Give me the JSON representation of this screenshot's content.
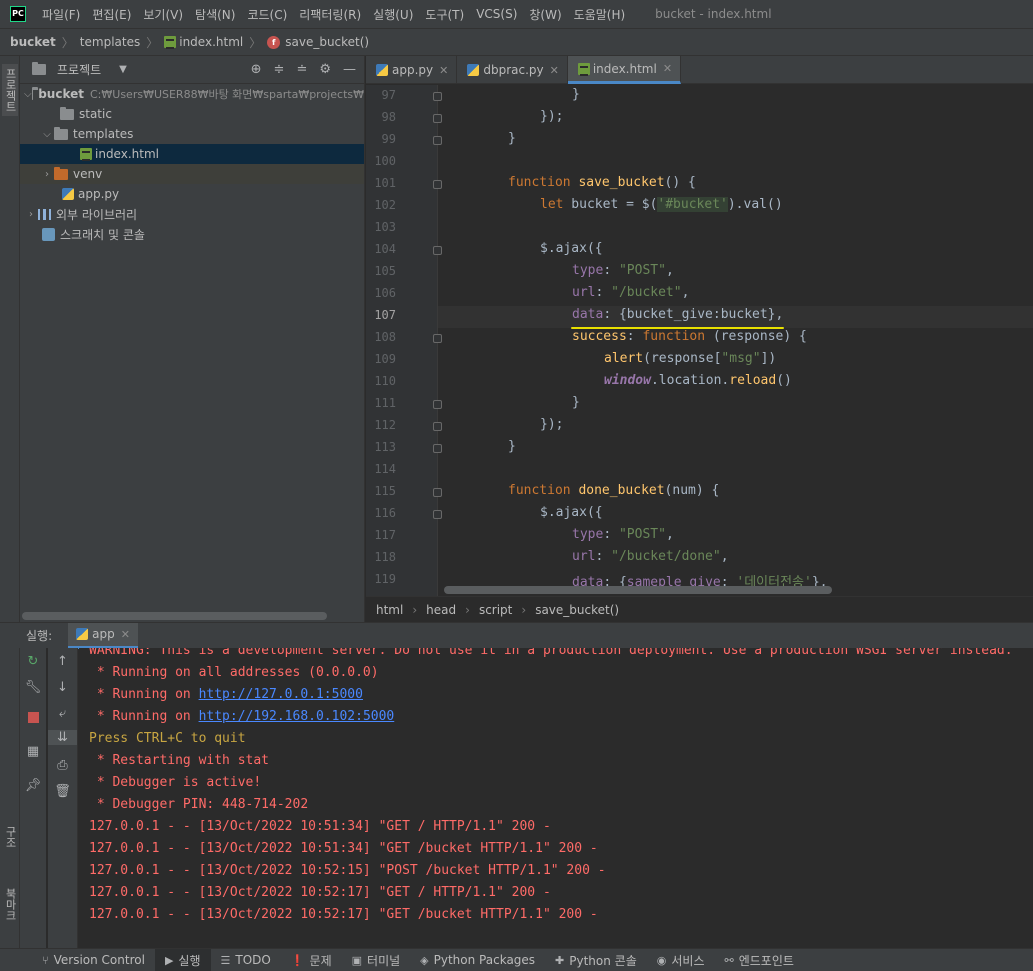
{
  "menu": {
    "items": [
      "파일(F)",
      "편집(E)",
      "보기(V)",
      "탐색(N)",
      "코드(C)",
      "리팩터링(R)",
      "실행(U)",
      "도구(T)",
      "VCS(S)",
      "창(W)",
      "도움말(H)"
    ],
    "window_title": "bucket - index.html",
    "logo": "PC"
  },
  "breadcrumb": {
    "project": "bucket",
    "folder": "templates",
    "file": "index.html",
    "func": "save_bucket()",
    "func_icon": "f"
  },
  "left_strip": {
    "project_tab": "프로젝트",
    "structure_tab": "구조",
    "bookmarks_tab": "북마크"
  },
  "project_panel": {
    "title": "프로젝트",
    "root": "bucket",
    "root_path": "C:₩Users₩USER88₩바탕 화면₩sparta₩projects₩",
    "items": {
      "static": "static",
      "templates": "templates",
      "index": "index.html",
      "venv": "venv",
      "app": "app.py",
      "libs": "외부 라이브러리",
      "scratch": "스크래치 및 콘솔"
    }
  },
  "editor_tabs": [
    {
      "label": "app.py"
    },
    {
      "label": "dbprac.py"
    },
    {
      "label": "index.html"
    }
  ],
  "line_numbers": [
    "97",
    "98",
    "99",
    "100",
    "101",
    "102",
    "103",
    "104",
    "105",
    "106",
    "107",
    "108",
    "109",
    "110",
    "111",
    "112",
    "113",
    "114",
    "115",
    "116",
    "117",
    "118",
    "119"
  ],
  "current_line": "107",
  "code": {
    "l97": "}",
    "l98": "});",
    "l99": "}",
    "kw_function": "function",
    "save_fn": "save_bucket",
    "done_fn": "done_bucket",
    "paren_open": "() {",
    "l102_let": "let",
    "l102_mid": " bucket = $(",
    "l102_str": "'#bucket'",
    "l102_end": ").val()",
    "ajax": "$.ajax({",
    "type_key": "type",
    "type_val": "\"POST\"",
    "url_key": "url",
    "url_val": "\"/bucket\"",
    "data_key": "data",
    "data_val": "{bucket_give:bucket}",
    "success_key": "success",
    "success_sig": "(response) {",
    "alert_fn": "alert",
    "alert_args_open": "(response[",
    "alert_str": "\"msg\"",
    "alert_args_close": "])",
    "window_obj": "window",
    "location": ".location.",
    "reload": "reload",
    "reload_paren": "()",
    "done_sig": "(num) {",
    "url_done_val": "\"/bucket/done\"",
    "data_done_open": "{",
    "data_done_key": "sameple_give",
    "data_done_str": "'데이터전송'",
    "data_done_close": "},"
  },
  "editor_breadcrumb": [
    "html",
    "head",
    "script",
    "save_bucket()"
  ],
  "run_panel": {
    "label": "실행:",
    "tab": "app",
    "lines": {
      "warning": "WARNING: This is a development server. Do not use it in a production deployment. Use a production WSGI server instead.",
      "running_all": " * Running on all addresses (0.0.0.0)",
      "running_prefix": " * Running on ",
      "url1": "http://127.0.0.1:5000",
      "url2": "http://192.168.0.102:5000",
      "press": "Press CTRL+C to quit",
      "restarting": " * Restarting with stat",
      "debugger": " * Debugger is active!",
      "pin": " * Debugger PIN: 448-714-202",
      "log1": "127.0.0.1 - - [13/Oct/2022 10:51:34] \"GET / HTTP/1.1\" 200 -",
      "log2": "127.0.0.1 - - [13/Oct/2022 10:51:34] \"GET /bucket HTTP/1.1\" 200 -",
      "log3": "127.0.0.1 - - [13/Oct/2022 10:52:15] \"POST /bucket HTTP/1.1\" 200 -",
      "log4": "127.0.0.1 - - [13/Oct/2022 10:52:17] \"GET / HTTP/1.1\" 200 -",
      "log5": "127.0.0.1 - - [13/Oct/2022 10:52:17] \"GET /bucket HTTP/1.1\" 200 -"
    }
  },
  "bottom_bar": [
    "Version Control",
    "실행",
    "TODO",
    "문제",
    "터미널",
    "Python Packages",
    "Python 콘솔",
    "서비스",
    "엔드포인트"
  ],
  "colors": {
    "background": "#2b2b2b",
    "panel": "#3c3f41",
    "keyword": "#cc7832",
    "function": "#ffc66d",
    "string": "#6a8759",
    "console_red": "#ff6b68",
    "link": "#4a88ff"
  }
}
